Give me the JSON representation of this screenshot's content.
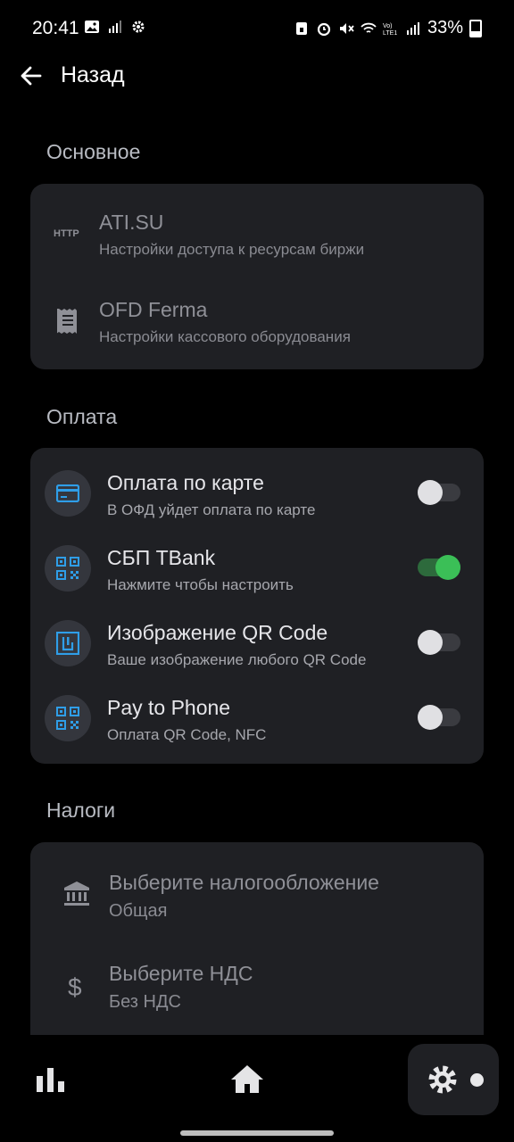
{
  "status_bar": {
    "time": "20:41",
    "battery": "33%"
  },
  "header": {
    "back_label": "Назад"
  },
  "sections": {
    "main": {
      "title": "Основное",
      "items": [
        {
          "title": "ATI.SU",
          "subtitle": "Настройки доступа к ресурсам биржи",
          "icon": "http-icon",
          "icon_text": "HTTP"
        },
        {
          "title": "OFD Ferma",
          "subtitle": "Настройки кассового оборудования",
          "icon": "receipt-icon"
        }
      ]
    },
    "payment": {
      "title": "Оплата",
      "items": [
        {
          "title": "Оплата по карте",
          "subtitle": "В ОФД уйдет оплата по карте",
          "icon": "credit-card-icon",
          "enabled": false
        },
        {
          "title": "СБП TBank",
          "subtitle": "Нажмите чтобы настроить",
          "icon": "qr-code-icon",
          "enabled": true
        },
        {
          "title": "Изображение QR Code",
          "subtitle": "Ваше изображение любого QR Code",
          "icon": "qr-image-icon",
          "enabled": false
        },
        {
          "title": "Pay to Phone",
          "subtitle": "Оплата QR Code, NFC",
          "icon": "qr-code-icon",
          "enabled": false
        }
      ]
    },
    "taxes": {
      "title": "Налоги",
      "items": [
        {
          "title": "Выберите налогообложение",
          "subtitle": "Общая",
          "icon": "bank-icon"
        },
        {
          "title": "Выберите НДС",
          "subtitle": "Без НДС",
          "icon": "dollar-icon"
        }
      ]
    }
  },
  "bottom_nav": [
    "stats-icon",
    "home-icon",
    "settings-icon"
  ],
  "colors": {
    "accent_blue": "#2f9ee8",
    "toggle_on": "#3bbf57",
    "card_bg": "#1f2024"
  }
}
